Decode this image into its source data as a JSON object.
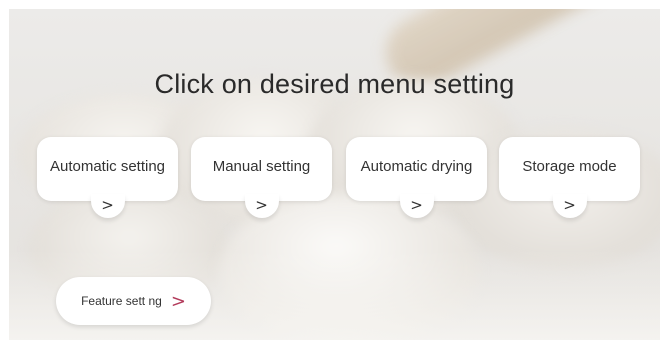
{
  "screen": {
    "title": "Click on desired menu setting"
  },
  "menu": {
    "items": [
      {
        "label": "Automatic setting",
        "icon": "chevron-right-icon",
        "glyph": ">"
      },
      {
        "label": "Manual setting",
        "icon": "chevron-right-icon",
        "glyph": ">"
      },
      {
        "label": "Automatic drying",
        "icon": "chevron-right-icon",
        "glyph": ">"
      },
      {
        "label": "Storage mode",
        "icon": "chevron-right-icon",
        "glyph": ">"
      }
    ]
  },
  "feature": {
    "label": "Feature sett ng",
    "icon": "chevron-right-icon",
    "glyph": ">",
    "chevron_color": "#b23a5a"
  }
}
